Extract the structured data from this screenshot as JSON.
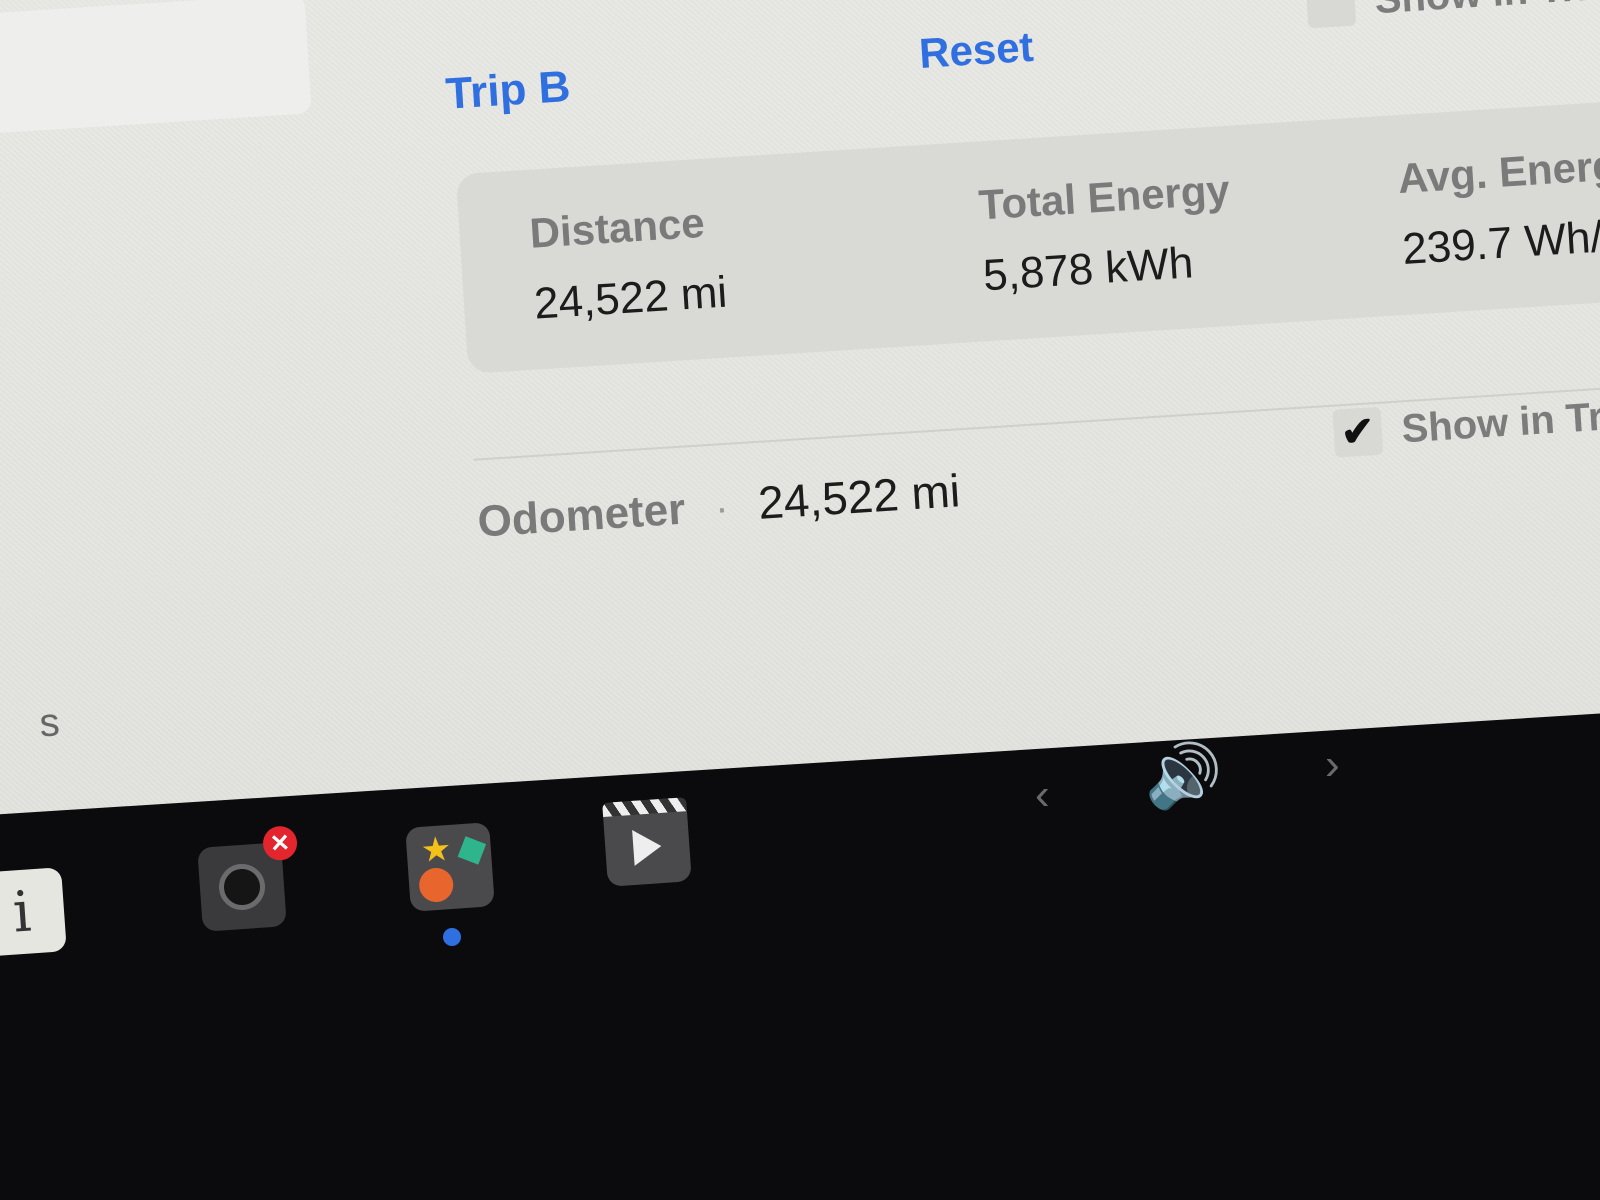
{
  "trip": {
    "title": "Trip B",
    "reset_label": "Reset",
    "show_in_trip_label": "Show in Tri",
    "stats": {
      "distance_label": "Distance",
      "distance_value": "24,522 mi",
      "total_energy_label": "Total Energy",
      "total_energy_value": "5,878 kWh",
      "avg_energy_label": "Avg. Energ",
      "avg_energy_value": "239.7 Wh/"
    }
  },
  "odometer": {
    "label": "Odometer",
    "separator": "·",
    "value": "24,522 mi",
    "show_in_trip_label": "Show in Tri",
    "show_in_trip_checked": true
  },
  "partial_text": "s",
  "dock": {
    "info_glyph": "i",
    "camera_badge": "✕",
    "prev_glyph": "‹",
    "next_glyph": "›",
    "volume_glyph": "🔊"
  },
  "colors": {
    "accent": "#2f6fe0",
    "screen_bg": "#e6e6e2",
    "dock_bg": "#0b0b0d",
    "badge": "#e3262e"
  }
}
